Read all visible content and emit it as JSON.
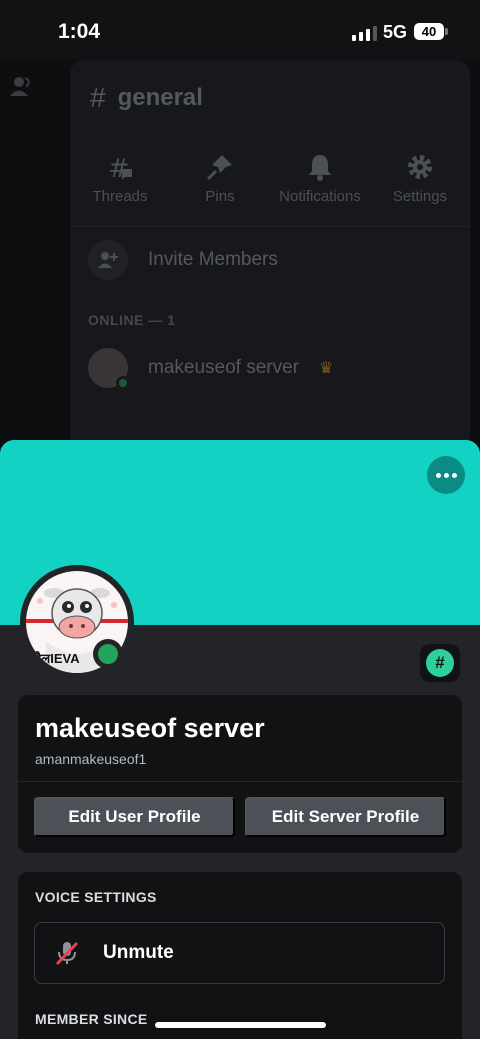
{
  "status_bar": {
    "time": "1:04",
    "network": "5G",
    "battery": "40"
  },
  "channel": {
    "name": "general",
    "tools": [
      {
        "label": "Threads",
        "icon": "threads-icon"
      },
      {
        "label": "Pins",
        "icon": "pin-icon"
      },
      {
        "label": "Notifications",
        "icon": "bell-icon"
      },
      {
        "label": "Settings",
        "icon": "gear-icon"
      }
    ],
    "invite_label": "Invite Members",
    "online_label": "ONLINE — 1",
    "member_name": "makeuseof server"
  },
  "profile": {
    "display_name": "makeuseof server",
    "username": "amanmakeuseof1",
    "avatar_text": "बैलIEVA",
    "badge_glyph": "#",
    "banner_color": "#12d3c3",
    "status_color": "#23a559",
    "edit_user_label": "Edit User Profile",
    "edit_server_label": "Edit Server Profile"
  },
  "voice": {
    "title": "VOICE SETTINGS",
    "unmute_label": "Unmute",
    "member_since_title": "MEMBER SINCE"
  }
}
